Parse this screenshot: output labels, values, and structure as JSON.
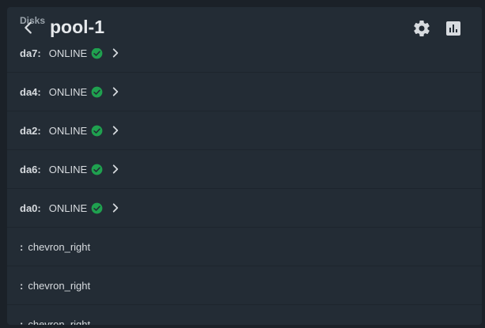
{
  "header": {
    "section_label": "Disks",
    "title": "pool-1"
  },
  "disks": [
    {
      "name": "da7:",
      "status": "ONLINE"
    },
    {
      "name": "da4:",
      "status": "ONLINE"
    },
    {
      "name": "da2:",
      "status": "ONLINE"
    },
    {
      "name": "da6:",
      "status": "ONLINE"
    },
    {
      "name": "da0:",
      "status": "ONLINE"
    }
  ],
  "empty_rows": [
    {
      "colon": ":",
      "icon_text": "chevron_right"
    },
    {
      "colon": ":",
      "icon_text": "chevron_right"
    },
    {
      "colon": ":",
      "icon_text": "chevron_right"
    }
  ],
  "colors": {
    "online_green": "#1fa14f"
  }
}
